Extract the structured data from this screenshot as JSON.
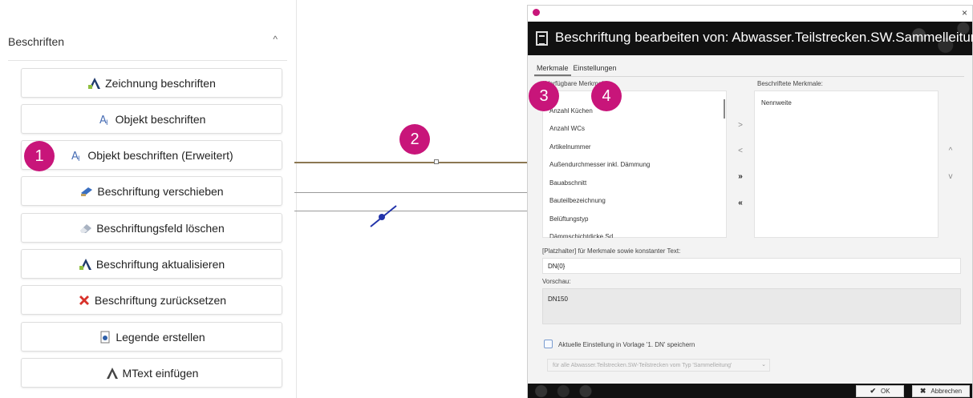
{
  "panel": {
    "title": "Beschriften",
    "collapse_glyph": "^",
    "buttons": [
      {
        "label": "Zeichnung beschriften",
        "icon": "A"
      },
      {
        "label": "Objekt beschriften",
        "icon": "A"
      },
      {
        "label": "Objekt beschriften (Erweitert)",
        "icon": "A"
      },
      {
        "label": "Beschriftung verschieben",
        "icon": "➜"
      },
      {
        "label": "Beschriftungsfeld löschen",
        "icon": "◆"
      },
      {
        "label": "Beschriftung aktualisieren",
        "icon": "A"
      },
      {
        "label": "Beschriftung zurücksetzen",
        "icon": "✖"
      },
      {
        "label": "Legende erstellen",
        "icon": "◉"
      },
      {
        "label": "MText einfügen",
        "icon": "A"
      }
    ]
  },
  "steps": [
    "1",
    "2",
    "3",
    "4"
  ],
  "dialog": {
    "title": "Beschriftung bearbeiten von: Abwasser.Teilstrecken.SW.Sammelleitung",
    "close_glyph": "×",
    "tabs": [
      "Merkmale",
      "Einstellungen"
    ],
    "available_label": "Verfügbare Merkmale:",
    "available_items": [
      "Anzahl Küchen",
      "Anzahl WCs",
      "Artikelnummer",
      "Außendurchmesser inkl. Dämmung",
      "Bauabschnitt",
      "Bauteilbezeichnung",
      "Belüftungstyp",
      "Dämmschichtdicke Sd"
    ],
    "selected_label": "Beschriftete Merkmale:",
    "selected_items": [
      "Nennweite"
    ],
    "move_buttons": [
      ">",
      "<",
      "»",
      "«"
    ],
    "order_buttons": [
      "^",
      "v"
    ],
    "placeholder_label": "[Platzhalter] für Merkmale sowie konstanter Text:",
    "placeholder_value": "DN{0}",
    "preview_label": "Vorschau:",
    "preview_value": "DN150",
    "save_checkbox_label": "Aktuelle Einstellung in Vorlage '1. DN' speichern",
    "scope_combo": "für alle Abwasser.Teilstrecken.SW-Teilstrecken vom Typ 'Sammelleitung'",
    "combo_chevron": "⌄",
    "ok_label": "OK",
    "ok_glyph": "✔",
    "cancel_label": "Abbrechen",
    "cancel_glyph": "✖"
  },
  "colors": {
    "step_badge": "#c8157a",
    "pipe_line": "#8b7752",
    "guide_line": "#9a9a9a",
    "cursor": "#2233aa",
    "banner": "#111111"
  }
}
